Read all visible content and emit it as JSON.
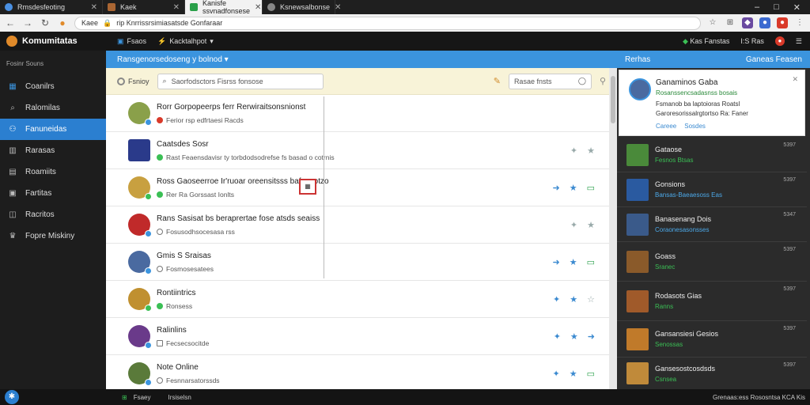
{
  "browser": {
    "tabs": [
      {
        "label": "Rmsdesfeoting"
      },
      {
        "label": "Kaek"
      },
      {
        "label": "Kanisfe ssvnadfonsese"
      },
      {
        "label": "Ksnewsalbonse"
      }
    ],
    "window_controls": {
      "minimize": "–",
      "maximize": "□",
      "close": "✕"
    },
    "url": "rip Knrrissrsimiasatsde Gonfaraar",
    "home_label": "Kaee"
  },
  "app": {
    "title": "Komumitatas",
    "header_items": [
      "Fsaos",
      "Kacktalhpot"
    ],
    "header_right": [
      "Kas Fanstas",
      "I:S Ras"
    ],
    "search_label": "Fosinr Souns"
  },
  "sidebar": {
    "items": [
      {
        "label": "Coanilrs",
        "icon": "squares-icon"
      },
      {
        "label": "Ralomilas",
        "icon": "search-icon"
      },
      {
        "label": "Fanuneidas",
        "icon": "people-icon"
      },
      {
        "label": "Rarasas",
        "icon": "book-icon"
      },
      {
        "label": "Roamiits",
        "icon": "list-icon"
      },
      {
        "label": "Fartitas",
        "icon": "calendar-icon"
      },
      {
        "label": "Racritos",
        "icon": "bag-icon"
      },
      {
        "label": "Fopre Miskiny",
        "icon": "trophy-icon"
      }
    ]
  },
  "bluebar": {
    "left": "Ransgenorsedoseng y bolnod",
    "right_left": "Rerhas",
    "right_right": "Ganeas Feasen"
  },
  "toolbar": {
    "filter_label": "Fsnioy",
    "search_placeholder": "Saorfodsctors Fisrss fonsose",
    "search2_placeholder": "Rasae fnsts"
  },
  "list": [
    {
      "title": "Rorr Gorpopeerps ferr Rerwiraitsonsnionst",
      "sub": "Ferior rsp edfrtaesi Racds",
      "avatar": "#8aa04a",
      "dot": "#d93a2a"
    },
    {
      "title": "Caatsdes Sosr",
      "sub": "Rast Feaensdavisr ty torbdodsodrefse fs basad o cotrnis",
      "avatar": "#2a3a8a",
      "dot": "#3bbf55"
    },
    {
      "title": "Ross Gaoseerroe Ir'ruoar oreensitsss bafoasotzo",
      "sub": "Rer Ra Gorssast Ionlts",
      "avatar": "#c8a040",
      "dot": "#3bbf55"
    },
    {
      "title": "Rans Sasisat bs beraprertae fose atsds seaiss",
      "sub": "Fosusodhsocesasa rss",
      "avatar": "#c02a2a",
      "dot": "#777"
    },
    {
      "title": "Gmis S Sraisas",
      "sub": "Fosmosesatees",
      "avatar": "#4a6aa0",
      "dot": "#888"
    },
    {
      "title": "Rontiintrics",
      "sub": "Ronsess",
      "avatar": "#c09030",
      "dot": "#3bbf55"
    },
    {
      "title": "Ralinlins",
      "sub": "Fecsecsocitde",
      "avatar": "#6a3a8a",
      "dot": "#888"
    },
    {
      "title": "Note Online",
      "sub": "Fesnnarsatorssds",
      "avatar": "#5a7a3a",
      "dot": "#888"
    }
  ],
  "featured": {
    "title": "Ganaminos Gaba",
    "line1": "Rosanssencsadasnss bosais",
    "line2": "Fsmanob ba laptoioras Roatsl",
    "line3": "Garoresorissalrgtortso Ra: Faner",
    "link1": "Careee",
    "link2": "Sosdes"
  },
  "right_items": [
    {
      "title": "Gataose",
      "sub": "Fesnos Btsas",
      "time": "5397",
      "thumb": "#4a8a3a",
      "subcolor": "green"
    },
    {
      "title": "Gonsions",
      "sub": "Bansas-Baeaesoss Eas",
      "time": "5397",
      "thumb": "#2a5aa0",
      "subcolor": "blue"
    },
    {
      "title": "Banasenang Dois",
      "sub": "Coraonesasonsses",
      "time": "5347",
      "thumb": "#3a5a8a",
      "subcolor": "blue"
    },
    {
      "title": "Goass",
      "sub": "Sranec",
      "time": "5397",
      "thumb": "#8a5a2a",
      "subcolor": "green"
    },
    {
      "title": "Rodasots Gias",
      "sub": "Ranns",
      "time": "5397",
      "thumb": "#a05a2a",
      "subcolor": "green"
    },
    {
      "title": "Gansansiesi Gesios",
      "sub": "Senossas",
      "time": "5397",
      "thumb": "#c07a2a",
      "subcolor": "green"
    },
    {
      "title": "Gansesostcosdsds",
      "sub": "Csnsea",
      "time": "5397",
      "thumb": "#c08a3a",
      "subcolor": "green"
    }
  ],
  "statusbar": {
    "left": "Fsaey",
    "mid": "Irsiselsn",
    "right": "Grenaas:ess Rososntsa KCA Kis"
  }
}
